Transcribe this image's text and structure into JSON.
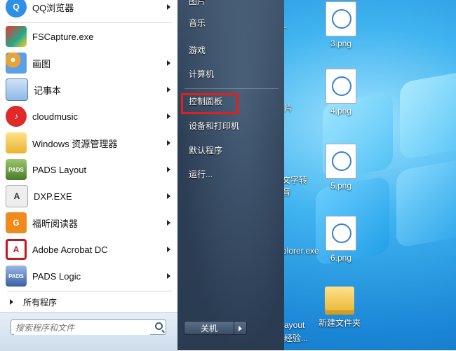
{
  "start_menu": {
    "apps": [
      {
        "label": "QQ浏览器",
        "icon": "qq-browser-icon",
        "has_arrow": true,
        "color": "#2f8fe8"
      },
      {
        "label": "FSCapture.exe",
        "icon": "fscapture-icon",
        "has_arrow": false,
        "color": "#d33"
      },
      {
        "label": "画图",
        "icon": "paint-icon",
        "has_arrow": true,
        "color": "#e7a23a"
      },
      {
        "label": "记事本",
        "icon": "notepad-icon",
        "has_arrow": true,
        "color": "#5b9bd5"
      },
      {
        "label": "cloudmusic",
        "icon": "cloudmusic-icon",
        "has_arrow": true,
        "color": "#e02a2a"
      },
      {
        "label": "Windows 资源管理器",
        "icon": "explorer-icon",
        "has_arrow": true,
        "color": "#e8b530"
      },
      {
        "label": "PADS Layout",
        "icon": "pads-layout-icon",
        "has_arrow": true,
        "color": "#4a7a2a"
      },
      {
        "label": "DXP.EXE",
        "icon": "dxp-icon",
        "has_arrow": true,
        "color": "#555"
      },
      {
        "label": "福昕阅读器",
        "icon": "foxit-reader-icon",
        "has_arrow": true,
        "color": "#f08a1c"
      },
      {
        "label": "Adobe Acrobat DC",
        "icon": "acrobat-icon",
        "has_arrow": true,
        "color": "#c4161c"
      },
      {
        "label": "PADS Logic",
        "icon": "pads-logic-icon",
        "has_arrow": true,
        "color": "#3a5fa0"
      }
    ],
    "all_programs": "所有程序",
    "search_placeholder": "搜索程序和文件",
    "right_items": [
      "图片",
      "音乐",
      "游戏",
      "计算机",
      "控制面板",
      "设备和打印机",
      "默认程序",
      "运行..."
    ],
    "shutdown_label": "关机"
  },
  "desktop": {
    "icons": [
      {
        "label": "3.png",
        "type": "thumb"
      },
      {
        "label": "4.png",
        "type": "thumb"
      },
      {
        "label": "5.png",
        "type": "thumb"
      },
      {
        "label": "6.png",
        "type": "thumb"
      },
      {
        "label": "新建文件夹",
        "type": "folder"
      }
    ],
    "partial_labels": [
      "工厂",
      "片",
      "文字转",
      "音",
      "plorer.exe",
      "ayout",
      "经验..."
    ]
  }
}
